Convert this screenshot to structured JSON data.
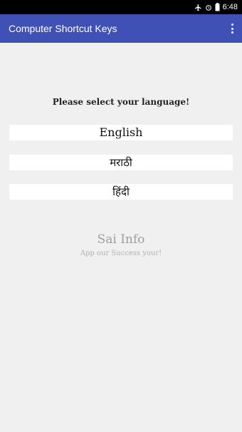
{
  "status_bar": {
    "time": "6:48",
    "icons": [
      "airplane-mode-icon",
      "alarm-icon",
      "battery-icon"
    ]
  },
  "app_bar": {
    "title": "Computer Shortcut Keys",
    "menu_icon": "overflow-menu-icon"
  },
  "main": {
    "prompt": "Please select your language!",
    "languages": [
      {
        "label": "English"
      },
      {
        "label": "मराठी"
      },
      {
        "label": "हिंदी"
      }
    ],
    "brand": "Sai Info",
    "tagline": "App our Success your!"
  },
  "colors": {
    "app_bar": "#3f51b5",
    "status_bar": "#000000",
    "background": "#f0f0f0",
    "brand_text": "#9e9e9e"
  }
}
